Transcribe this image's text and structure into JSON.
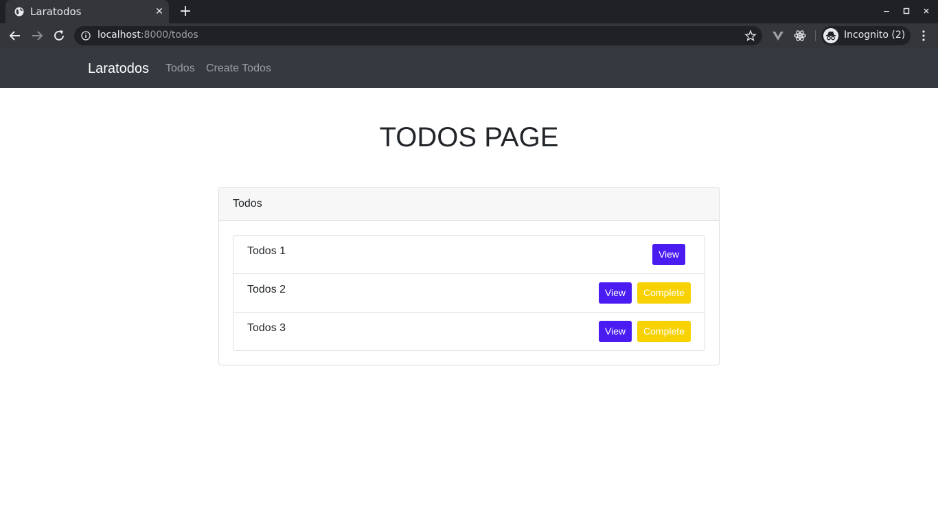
{
  "browser": {
    "tab_title": "Laratodos",
    "tab_close": "✕",
    "new_tab": "+",
    "url_host": "localhost",
    "url_rest": ":8000/todos",
    "profile_label": "Incognito (2)"
  },
  "navbar": {
    "brand": "Laratodos",
    "links": [
      "Todos",
      "Create Todos"
    ]
  },
  "page": {
    "title": "TODOS PAGE"
  },
  "card": {
    "header": "Todos",
    "items": [
      {
        "label": "Todos 1",
        "view_label": "View"
      },
      {
        "label": "Todos 2",
        "view_label": "View",
        "complete_label": "Complete"
      },
      {
        "label": "Todos 3",
        "view_label": "View",
        "complete_label": "Complete"
      }
    ]
  },
  "colors": {
    "navbar_bg": "#343a40",
    "view_button": "#4a1cf2",
    "complete_button": "#f7d100"
  }
}
